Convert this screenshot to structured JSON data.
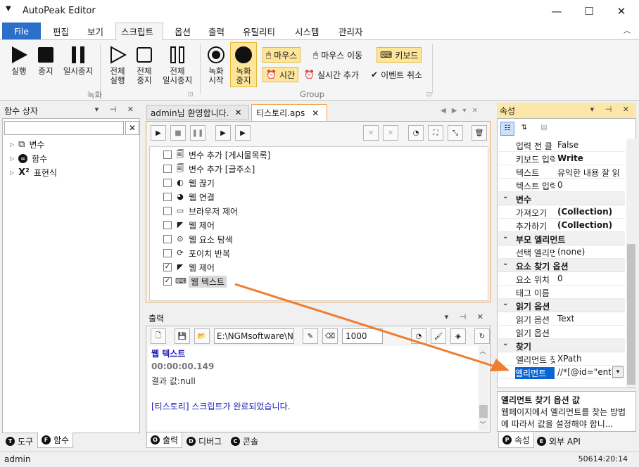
{
  "window": {
    "title": "AutoPeak Editor"
  },
  "menu": {
    "file": "File",
    "items": [
      "편집",
      "보기",
      "스크립트",
      "옵션",
      "출력",
      "유틸리티",
      "시스템",
      "관리자"
    ]
  },
  "ribbon": {
    "run": "실행",
    "stop": "중지",
    "pause": "일시중지",
    "all_run": [
      "전체",
      "실행"
    ],
    "all_stop": [
      "전체",
      "중지"
    ],
    "all_pause": [
      "전체",
      "일시중지"
    ],
    "rec_start": [
      "녹화",
      "시작"
    ],
    "rec_stop": [
      "녹화",
      "중지"
    ],
    "group_record": "녹화",
    "group_group": "Group",
    "mouse": "마우스",
    "mouse_move": "마우스 이동",
    "keyboard": "키보드",
    "time": "시간",
    "realtime_add": "실시간 추가",
    "event_cancel": "이벤트 취소"
  },
  "left_panel": {
    "title": "함수 상자",
    "search_value": "",
    "items": [
      "변수",
      "함수",
      "표현식"
    ],
    "tabs": [
      "도구",
      "함수"
    ]
  },
  "doc_tabs": [
    "admin님 환영합니다.",
    "티스토리.aps"
  ],
  "script_rows": [
    {
      "checked": false,
      "label": "변수 추가 [게시물목록]"
    },
    {
      "checked": false,
      "label": "변수 추가 [글주소]"
    },
    {
      "checked": false,
      "label": "웹 끊기"
    },
    {
      "checked": false,
      "label": "웹 연결"
    },
    {
      "checked": false,
      "label": "브라우저 제어"
    },
    {
      "checked": false,
      "label": "웹 제어"
    },
    {
      "checked": false,
      "label": "웹 요소 탐색"
    },
    {
      "checked": false,
      "label": "포이치 반복"
    },
    {
      "checked": true,
      "label": "웹 제어"
    },
    {
      "checked": true,
      "label": "웹 텍스트"
    }
  ],
  "output": {
    "title": "출력",
    "path": "E:\\NGMsoftware\\NG",
    "count": "1000",
    "lines": [
      "웹 텍스트",
      "00:00:00.149",
      "결과 값:null",
      "",
      "[티스토리] 스크립트가 완료되었습니다."
    ],
    "tabs": [
      "출력",
      "디버그",
      "콘솔"
    ]
  },
  "properties": {
    "title": "속성",
    "rows": [
      {
        "type": "row",
        "k": "입력 전 클",
        "v": "False"
      },
      {
        "type": "row",
        "k": "키보드 입력",
        "v": "Write",
        "bold": true
      },
      {
        "type": "row",
        "k": "텍스트",
        "v": "유익한 내용 잘 읽"
      },
      {
        "type": "row",
        "k": "텍스트 입력",
        "v": "0"
      },
      {
        "type": "cat",
        "k": "변수"
      },
      {
        "type": "row",
        "k": "가져오기",
        "v": "(Collection)",
        "bold": true
      },
      {
        "type": "row",
        "k": "추가하기",
        "v": "(Collection)",
        "bold": true
      },
      {
        "type": "cat",
        "k": "부모 엘리먼트"
      },
      {
        "type": "row",
        "k": "선택 엘리먼",
        "v": "(none)"
      },
      {
        "type": "cat",
        "k": "요소 찾기 옵션"
      },
      {
        "type": "row",
        "k": "요소 위치",
        "v": "0"
      },
      {
        "type": "row",
        "k": "태그 이름",
        "v": ""
      },
      {
        "type": "cat",
        "k": "읽기 옵션"
      },
      {
        "type": "row",
        "k": "읽기 옵션",
        "v": "Text"
      },
      {
        "type": "row",
        "k": "읽기 옵션",
        "v": ""
      },
      {
        "type": "cat",
        "k": "찾기"
      },
      {
        "type": "row",
        "k": "엘리먼트 찾",
        "v": "XPath"
      },
      {
        "type": "row",
        "k": "엘리먼트",
        "v": "//*[@id=\"ent",
        "selected": true
      }
    ],
    "desc_title": "엘리먼트 찾기 옵션 값",
    "desc_text": "웹페이지에서 엘리먼트를 찾는 방법에 따라서 값을 설정해야 합니...",
    "tabs": [
      "속성",
      "외부 API"
    ]
  },
  "status": {
    "user": "admin",
    "right": "50614:20:14"
  },
  "colors": {
    "accent": "#2b6fc9",
    "highlight": "#fde69a",
    "arrow": "#f07c2e",
    "selection": "#0a64d4"
  }
}
